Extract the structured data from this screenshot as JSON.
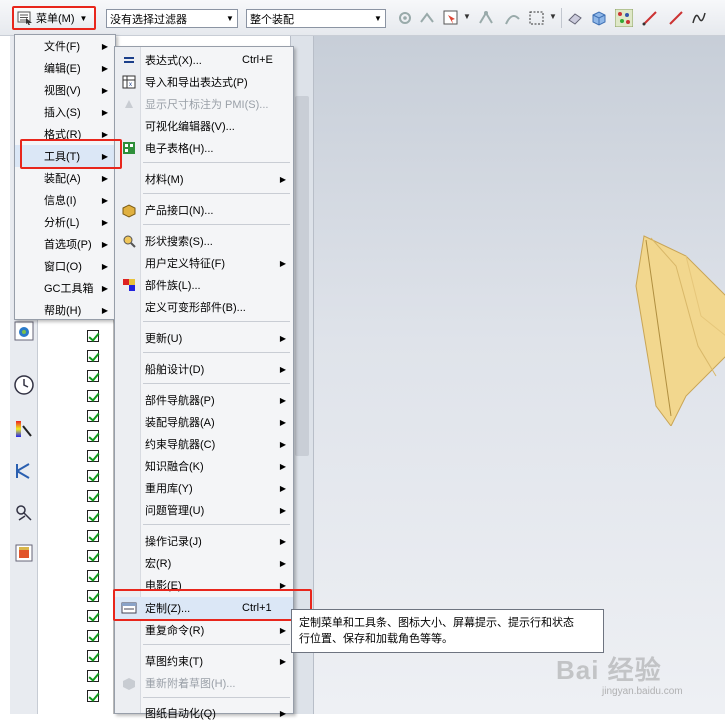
{
  "toolbar": {
    "menu_label": "菜单(M)",
    "filter_value": "没有选择过滤器",
    "assembly_value": "整个装配"
  },
  "main_menu": {
    "items": [
      {
        "label": "文件(F)",
        "submenu": true
      },
      {
        "label": "编辑(E)",
        "submenu": true
      },
      {
        "label": "视图(V)",
        "submenu": true
      },
      {
        "label": "插入(S)",
        "submenu": true
      },
      {
        "label": "格式(R)",
        "submenu": true
      },
      {
        "label": "工具(T)",
        "submenu": true,
        "highlighted": true
      },
      {
        "label": "装配(A)",
        "submenu": true
      },
      {
        "label": "信息(I)",
        "submenu": true
      },
      {
        "label": "分析(L)",
        "submenu": true
      },
      {
        "label": "首选项(P)",
        "submenu": true
      },
      {
        "label": "窗口(O)",
        "submenu": true
      },
      {
        "label": "GC工具箱",
        "submenu": true
      },
      {
        "label": "帮助(H)",
        "submenu": true
      }
    ]
  },
  "tools_menu": {
    "items": [
      {
        "label": "表达式(X)...",
        "shortcut": "Ctrl+E",
        "icon": "equals-icon"
      },
      {
        "label": "导入和导出表达式(P)",
        "icon": "spreadsheet-import-icon"
      },
      {
        "label": "显示尺寸标注为 PMI(S)...",
        "disabled": true,
        "icon": "pmi-dimension-icon"
      },
      {
        "label": "可视化编辑器(V)..."
      },
      {
        "label": "电子表格(H)...",
        "icon": "spreadsheet-icon"
      },
      {
        "label": "材料(M)",
        "submenu": true
      },
      {
        "label": "产品接口(N)...",
        "icon": "product-interface-icon"
      },
      {
        "label": "形状搜索(S)...",
        "icon": "shape-search-icon"
      },
      {
        "label": "用户定义特征(F)",
        "submenu": true
      },
      {
        "label": "部件族(L)...",
        "icon": "part-family-icon"
      },
      {
        "label": "定义可变形部件(B)..."
      },
      {
        "label": "更新(U)",
        "submenu": true
      },
      {
        "label": "船舶设计(D)",
        "submenu": true
      },
      {
        "label": "部件导航器(P)",
        "submenu": true
      },
      {
        "label": "装配导航器(A)",
        "submenu": true
      },
      {
        "label": "约束导航器(C)",
        "submenu": true
      },
      {
        "label": "知识融合(K)",
        "submenu": true
      },
      {
        "label": "重用库(Y)",
        "submenu": true
      },
      {
        "label": "问题管理(U)",
        "submenu": true
      },
      {
        "label": "操作记录(J)",
        "submenu": true
      },
      {
        "label": "宏(R)",
        "submenu": true
      },
      {
        "label": "电影(E)",
        "submenu": true
      },
      {
        "label": "定制(Z)...",
        "shortcut": "Ctrl+1",
        "icon": "customize-icon",
        "highlighted": true
      },
      {
        "label": "重复命令(R)",
        "submenu": true
      },
      {
        "label": "草图约束(T)",
        "submenu": true
      },
      {
        "label": "重新附着草图(H)...",
        "disabled": true,
        "icon": "reattach-sketch-icon"
      },
      {
        "label": "图纸自动化(Q)",
        "submenu": true
      }
    ]
  },
  "tooltip": {
    "line1": "定制菜单和工具条、图标大小、屏幕提示、提示行和状态",
    "line2": "行位置、保存和加载角色等等。"
  },
  "watermark": {
    "main": "Bai 经验",
    "sub": "jingyan.baidu.com"
  },
  "colors": {
    "highlight_box": "#e8261c",
    "menu_bg": "#f4f5f7",
    "model_fill": "#f2d78e"
  }
}
